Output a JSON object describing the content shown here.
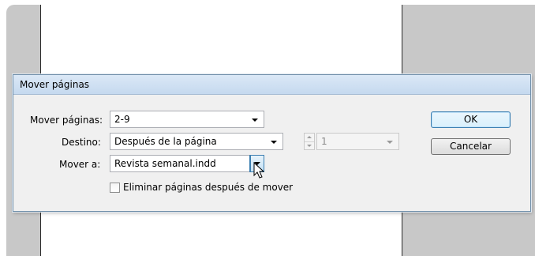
{
  "dialog": {
    "title": "Mover páginas",
    "rows": {
      "move_pages": {
        "label": "Mover páginas:",
        "value": "2-9"
      },
      "destination": {
        "label": "Destino:",
        "value": "Después de la página",
        "page_number": "1"
      },
      "move_to": {
        "label": "Mover a:",
        "value": "Revista semanal.indd"
      }
    },
    "checkbox": {
      "label": "Eliminar páginas después de mover",
      "checked": false
    },
    "buttons": {
      "ok": "OK",
      "cancel": "Cancelar"
    }
  },
  "icons": {
    "dropdown": "chevron-down-icon",
    "spinner": "spinner-icon",
    "cursor": "mouse-pointer-icon"
  },
  "colors": {
    "canvas_bg": "#c8c8c8",
    "dialog_bg": "#f0f0f0",
    "titlebar": "#c5d9ef",
    "focus_blue": "#3c7fb1"
  }
}
